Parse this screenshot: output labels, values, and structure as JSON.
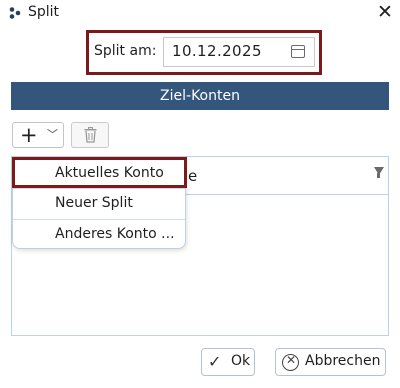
{
  "window": {
    "title": "Split"
  },
  "date": {
    "label": "Split am:",
    "value": "10.12.2025"
  },
  "section": {
    "title": "Ziel-Konten"
  },
  "grid": {
    "header_partial": "e"
  },
  "menu": {
    "items": [
      "Aktuelles Konto",
      "Neuer Split",
      "Anderes Konto ..."
    ]
  },
  "buttons": {
    "ok": "Ok",
    "cancel": "Abbrechen"
  },
  "colors": {
    "accent_band": "#34567d",
    "highlight_border": "#7b1a1a"
  }
}
